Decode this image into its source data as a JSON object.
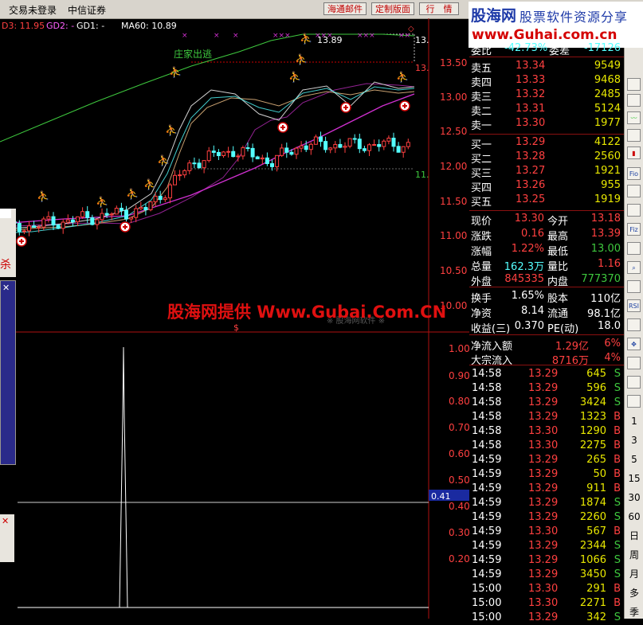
{
  "topbar": {
    "title": "交易未登录",
    "broker": "中信证券",
    "buttons": [
      "海通邮件",
      "定制版面",
      "行　情"
    ]
  },
  "logo": {
    "site": "股海网",
    "slogan": "股票软件资源分享",
    "url": "www.Guhai.com.cn"
  },
  "indicators": {
    "d3": "D3: 11.95",
    "gd2": "GD2: -",
    "gd1": "GD1: -",
    "ma60": "MA60: 10.89"
  },
  "chart_marks": {
    "peak_label": "13.89",
    "top_right": "13.",
    "mid_right": "13.",
    "low_right": "11.",
    "escape_label": "庄家出逃",
    "dollar": "$",
    "faint_label": "※ 股海网软件 ※",
    "small_label": "杀"
  },
  "price_axis": [
    "13.50",
    "13.00",
    "12.50",
    "12.00",
    "11.50",
    "11.00",
    "10.50",
    "10.00"
  ],
  "sub_axis": [
    "1.00",
    "0.90",
    "0.80",
    "0.70",
    "0.60",
    "0.50",
    "0.40",
    "0.30",
    "0.20"
  ],
  "sub_marker": "0.41",
  "watermark": "股海网提供 Www.Gubai.Com.CN",
  "quote": {
    "weibi": {
      "label": "委比",
      "value": "-42.73%",
      "label2": "委差",
      "value2": "-17126"
    },
    "asks": [
      {
        "label": "卖五",
        "price": "13.34",
        "vol": "9549"
      },
      {
        "label": "卖四",
        "price": "13.33",
        "vol": "9468"
      },
      {
        "label": "卖三",
        "price": "13.32",
        "vol": "2485"
      },
      {
        "label": "卖二",
        "price": "13.31",
        "vol": "5124"
      },
      {
        "label": "卖一",
        "price": "13.30",
        "vol": "1977"
      }
    ],
    "bids": [
      {
        "label": "买一",
        "price": "13.29",
        "vol": "4122"
      },
      {
        "label": "买二",
        "price": "13.28",
        "vol": "2560"
      },
      {
        "label": "买三",
        "price": "13.27",
        "vol": "1921"
      },
      {
        "label": "买四",
        "price": "13.26",
        "vol": "955"
      },
      {
        "label": "买五",
        "price": "13.25",
        "vol": "1919"
      }
    ],
    "stats": [
      {
        "l1": "现价",
        "v1": "13.30",
        "l2": "今开",
        "v2": "13.18"
      },
      {
        "l1": "涨跌",
        "v1": "0.16",
        "l2": "最高",
        "v2": "13.39"
      },
      {
        "l1": "涨幅",
        "v1": "1.22%",
        "l2": "最低",
        "v2": "13.00"
      },
      {
        "l1": "总量",
        "v1": "162.3万",
        "l2": "量比",
        "v2": "1.16"
      },
      {
        "l1": "外盘",
        "v1": "845335",
        "l2": "内盘",
        "v2": "777370"
      }
    ],
    "stats2": [
      {
        "l1": "换手",
        "v1": "1.65%",
        "l2": "股本",
        "v2": "110亿"
      },
      {
        "l1": "净资",
        "v1": "8.14",
        "l2": "流通",
        "v2": "98.1亿"
      },
      {
        "l1": "收益(三)",
        "v1": "0.370",
        "l2": "PE(动)",
        "v2": "18.0"
      }
    ],
    "flows": [
      {
        "label": "净流入额",
        "value": "1.29亿",
        "pct": "6%"
      },
      {
        "label": "大宗流入",
        "value": "8716万",
        "pct": "4%"
      }
    ],
    "ticks": [
      {
        "t": "14:58",
        "p": "13.29",
        "v": "645",
        "s": "S"
      },
      {
        "t": "14:58",
        "p": "13.29",
        "v": "596",
        "s": "S"
      },
      {
        "t": "14:58",
        "p": "13.29",
        "v": "3424",
        "s": "S"
      },
      {
        "t": "14:58",
        "p": "13.29",
        "v": "1323",
        "s": "B"
      },
      {
        "t": "14:58",
        "p": "13.30",
        "v": "1290",
        "s": "B"
      },
      {
        "t": "14:58",
        "p": "13.30",
        "v": "2275",
        "s": "B"
      },
      {
        "t": "14:59",
        "p": "13.29",
        "v": "265",
        "s": "B"
      },
      {
        "t": "14:59",
        "p": "13.29",
        "v": "50",
        "s": "B"
      },
      {
        "t": "14:59",
        "p": "13.29",
        "v": "911",
        "s": "B"
      },
      {
        "t": "14:59",
        "p": "13.29",
        "v": "1874",
        "s": "S"
      },
      {
        "t": "14:59",
        "p": "13.29",
        "v": "2260",
        "s": "S"
      },
      {
        "t": "14:59",
        "p": "13.30",
        "v": "567",
        "s": "B"
      },
      {
        "t": "14:59",
        "p": "13.29",
        "v": "2344",
        "s": "S"
      },
      {
        "t": "14:59",
        "p": "13.29",
        "v": "1066",
        "s": "S"
      },
      {
        "t": "14:59",
        "p": "13.29",
        "v": "3450",
        "s": "S"
      },
      {
        "t": "15:00",
        "p": "13.30",
        "v": "291",
        "s": "B"
      },
      {
        "t": "15:00",
        "p": "13.30",
        "v": "2271",
        "s": "B"
      },
      {
        "t": "15:00",
        "p": "13.29",
        "v": "342",
        "s": "S"
      }
    ]
  },
  "toolbar": {
    "icons": [
      "Fio",
      "Fiz",
      "RSI"
    ],
    "numbers": [
      "1",
      "3",
      "5",
      "15",
      "30",
      "60"
    ],
    "periods": [
      "日",
      "周",
      "月",
      "多",
      "季"
    ]
  },
  "colors": {
    "up": "#ff4040",
    "down": "#54ffff",
    "flat": "#ffffff",
    "axis": "#b01010",
    "ma_green": "#3ec83e",
    "ma_magenta": "#d030d0",
    "label_yellow": "#e8e800"
  }
}
